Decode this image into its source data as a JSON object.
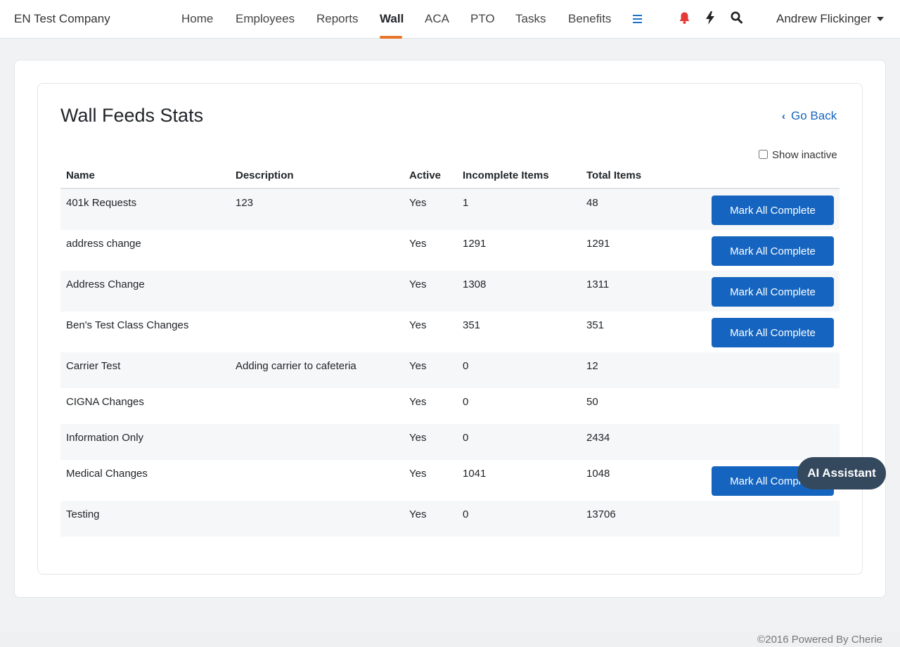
{
  "header": {
    "company": "EN Test Company",
    "nav": [
      {
        "label": "Home",
        "active": false
      },
      {
        "label": "Employees",
        "active": false
      },
      {
        "label": "Reports",
        "active": false
      },
      {
        "label": "Wall",
        "active": true
      },
      {
        "label": "ACA",
        "active": false
      },
      {
        "label": "PTO",
        "active": false
      },
      {
        "label": "Tasks",
        "active": false
      },
      {
        "label": "Benefits",
        "active": false
      }
    ],
    "icons": [
      "menu-icon",
      "bell-icon",
      "bolt-icon",
      "search-icon"
    ],
    "user_name": "Andrew Flickinger",
    "accent_color": "#e8742a",
    "alert_color": "#e53935"
  },
  "page": {
    "title": "Wall Feeds Stats",
    "go_back_label": "Go Back",
    "show_inactive_label": "Show inactive",
    "show_inactive_checked": false
  },
  "table": {
    "columns": [
      "Name",
      "Description",
      "Active",
      "Incomplete Items",
      "Total Items"
    ],
    "button_label": "Mark All Complete",
    "button_color": "#1565c0",
    "rows": [
      {
        "name": "401k Requests",
        "description": "123",
        "active": "Yes",
        "incomplete": "1",
        "total": "48",
        "has_button": true
      },
      {
        "name": "address change",
        "description": "",
        "active": "Yes",
        "incomplete": "1291",
        "total": "1291",
        "has_button": true
      },
      {
        "name": "Address Change",
        "description": "",
        "active": "Yes",
        "incomplete": "1308",
        "total": "1311",
        "has_button": true
      },
      {
        "name": "Ben's Test Class Changes",
        "description": "",
        "active": "Yes",
        "incomplete": "351",
        "total": "351",
        "has_button": true
      },
      {
        "name": "Carrier Test",
        "description": "Adding carrier to cafeteria",
        "active": "Yes",
        "incomplete": "0",
        "total": "12",
        "has_button": false
      },
      {
        "name": "CIGNA Changes",
        "description": "",
        "active": "Yes",
        "incomplete": "0",
        "total": "50",
        "has_button": false
      },
      {
        "name": "Information Only",
        "description": "",
        "active": "Yes",
        "incomplete": "0",
        "total": "2434",
        "has_button": false
      },
      {
        "name": "Medical Changes",
        "description": "",
        "active": "Yes",
        "incomplete": "1041",
        "total": "1048",
        "has_button": true
      },
      {
        "name": "Testing",
        "description": "",
        "active": "Yes",
        "incomplete": "0",
        "total": "13706",
        "has_button": false
      }
    ]
  },
  "assistant": {
    "label": "AI Assistant"
  },
  "footer": {
    "text": "©2016 Powered By Cherie"
  }
}
